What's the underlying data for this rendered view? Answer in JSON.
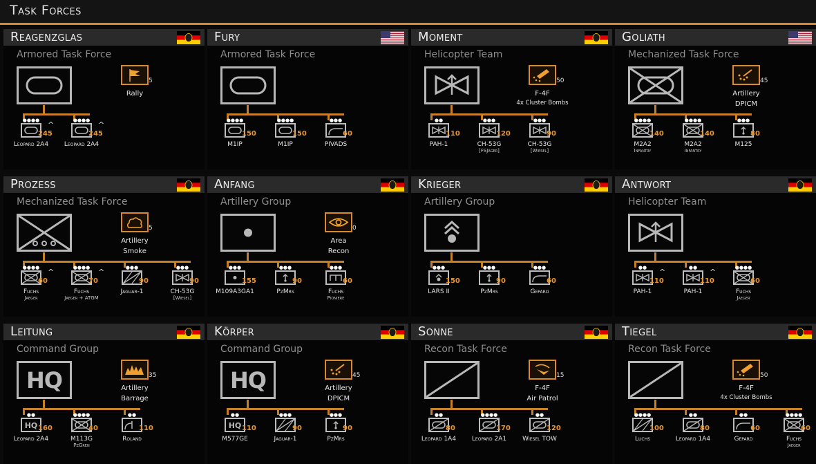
{
  "header": {
    "title": "Task Forces"
  },
  "colors": {
    "accent": "#d9892f",
    "header_bg": "#2a2a2a",
    "symbol": "#b8b8b8"
  },
  "cards": [
    {
      "name": "Reagenzglas",
      "flag": "germany-flag-icon",
      "type": "Armored Task Force",
      "hq": "armor",
      "support": {
        "label": "Rally",
        "sub": "",
        "count": "5",
        "icon": "flag-icon"
      },
      "units": [
        {
          "dots": "●●●●",
          "icon": "tank",
          "count": "245",
          "name": "Leopard 2A4",
          "sub": "",
          "caret": "^"
        },
        {
          "dots": "●●●●",
          "icon": "tank",
          "count": "245",
          "name": "Leopard 2A4",
          "sub": "",
          "caret": "^"
        }
      ]
    },
    {
      "name": "Fury",
      "flag": "usa-flag-icon",
      "type": "Armored Task Force",
      "hq": "armor",
      "support": null,
      "units": [
        {
          "dots": "●●●●",
          "icon": "tank",
          "count": "150",
          "name": "M1IP",
          "sub": "",
          "caret": ""
        },
        {
          "dots": "●●●●",
          "icon": "tank",
          "count": "150",
          "name": "M1IP",
          "sub": "",
          "caret": ""
        },
        {
          "dots": "●●●",
          "icon": "aa-gun",
          "count": "60",
          "name": "PIVADS",
          "sub": "",
          "caret": ""
        }
      ]
    },
    {
      "name": "Moment",
      "flag": "germany-flag-icon",
      "type": "Helicopter Team",
      "hq": "heli",
      "support": {
        "label": "F-4F",
        "sub": "4x Cluster Bombs",
        "count": "50",
        "icon": "cluster-bomb-icon"
      },
      "units": [
        {
          "dots": "●●",
          "icon": "heli",
          "count": "110",
          "name": "PAH-1",
          "sub": "",
          "caret": ""
        },
        {
          "dots": "●●●",
          "icon": "heli",
          "count": "120",
          "name": "CH-53G",
          "sub": "[FSJäger]",
          "caret": ""
        },
        {
          "dots": "●●●",
          "icon": "heli",
          "count": "90",
          "name": "CH-53G",
          "sub": "[Wiesel]",
          "caret": ""
        }
      ]
    },
    {
      "name": "Goliath",
      "flag": "usa-flag-icon",
      "type": "Mechanized Task Force",
      "hq": "mech",
      "support": {
        "label": "Artillery",
        "sub": "DPICM",
        "count": "45",
        "icon": "dpicm-icon"
      },
      "units": [
        {
          "dots": "●●●●",
          "icon": "ifv",
          "count": "140",
          "name": "M2A2",
          "sub": "Infantry",
          "caret": ""
        },
        {
          "dots": "●●●●",
          "icon": "ifv",
          "count": "140",
          "name": "M2A2",
          "sub": "Infantry",
          "caret": ""
        },
        {
          "dots": "●●●",
          "icon": "mortar",
          "count": "80",
          "name": "M125",
          "sub": "",
          "caret": ""
        }
      ]
    },
    {
      "name": "Prozess",
      "flag": "germany-flag-icon",
      "type": "Mechanized Task Force",
      "hq": "mech-wheeled",
      "support": {
        "label": "Artillery",
        "sub": "Smoke",
        "count": "5",
        "icon": "smoke-icon"
      },
      "units": [
        {
          "dots": "●●●●",
          "icon": "ifv",
          "count": "60",
          "name": "Fuchs",
          "sub": "Jaeger",
          "caret": "^"
        },
        {
          "dots": "●●●●",
          "icon": "ifv",
          "count": "70",
          "name": "Fuchs",
          "sub": "Jaeger + ATGM",
          "caret": "^"
        },
        {
          "dots": "●●●",
          "icon": "recon",
          "count": "90",
          "name": "Jaguar-1",
          "sub": "",
          "caret": ""
        },
        {
          "dots": "●●●",
          "icon": "heli",
          "count": "90",
          "name": "CH-53G",
          "sub": "[Wiesel]",
          "caret": ""
        }
      ]
    },
    {
      "name": "Anfang",
      "flag": "germany-flag-icon",
      "type": "Artillery Group",
      "hq": "artillery",
      "support": {
        "label": "Area",
        "sub": "Recon",
        "count": "0",
        "icon": "eye-icon"
      },
      "units": [
        {
          "dots": "●●●",
          "icon": "artillery",
          "count": "155",
          "name": "M109A3GA1",
          "sub": "",
          "caret": ""
        },
        {
          "dots": "●●●",
          "icon": "mortar",
          "count": "90",
          "name": "PzMrs",
          "sub": "",
          "caret": ""
        },
        {
          "dots": "●●●",
          "icon": "engineer",
          "count": "60",
          "name": "Fuchs",
          "sub": "Pioniere",
          "caret": ""
        }
      ]
    },
    {
      "name": "Krieger",
      "flag": "germany-flag-icon",
      "type": "Artillery Group",
      "hq": "rocket",
      "support": null,
      "units": [
        {
          "dots": "●●●",
          "icon": "rocket",
          "count": "150",
          "name": "LARS II",
          "sub": "",
          "caret": ""
        },
        {
          "dots": "●●●",
          "icon": "mortar",
          "count": "90",
          "name": "PzMrs",
          "sub": "",
          "caret": ""
        },
        {
          "dots": "●●●",
          "icon": "aa-gun",
          "count": "60",
          "name": "Gepard",
          "sub": "",
          "caret": ""
        }
      ]
    },
    {
      "name": "Antwort",
      "flag": "germany-flag-icon",
      "type": "Helicopter Team",
      "hq": "heli",
      "support": null,
      "units": [
        {
          "dots": "●●",
          "icon": "heli",
          "count": "110",
          "name": "PAH-1",
          "sub": "",
          "caret": "^"
        },
        {
          "dots": "●●",
          "icon": "heli",
          "count": "110",
          "name": "PAH-1",
          "sub": "",
          "caret": "^"
        },
        {
          "dots": "●●●●",
          "icon": "ifv",
          "count": "60",
          "name": "Fuchs",
          "sub": "Jaeger",
          "caret": ""
        }
      ]
    },
    {
      "name": "Leitung",
      "flag": "germany-flag-icon",
      "type": "Command Group",
      "hq": "hq",
      "support": {
        "label": "Artillery",
        "sub": "Barrage",
        "count": "35",
        "icon": "barrage-icon"
      },
      "units": [
        {
          "dots": "●●",
          "icon": "hq",
          "count": "160",
          "name": "Leopard 2A4",
          "sub": "",
          "caret": ""
        },
        {
          "dots": "●●●●",
          "icon": "ifv",
          "count": "40",
          "name": "M113G",
          "sub": "PzGren",
          "caret": ""
        },
        {
          "dots": "●●",
          "icon": "sam",
          "count": "110",
          "name": "Roland",
          "sub": "",
          "caret": ""
        }
      ]
    },
    {
      "name": "Körper",
      "flag": "germany-flag-icon",
      "type": "Command Group",
      "hq": "hq",
      "support": {
        "label": "Artillery",
        "sub": "DPICM",
        "count": "45",
        "icon": "dpicm-icon"
      },
      "units": [
        {
          "dots": "●●",
          "icon": "hq",
          "count": "110",
          "name": "M577GE",
          "sub": "",
          "caret": ""
        },
        {
          "dots": "●●●",
          "icon": "recon",
          "count": "90",
          "name": "Jaguar-1",
          "sub": "",
          "caret": ""
        },
        {
          "dots": "●●●",
          "icon": "mortar",
          "count": "90",
          "name": "PzMrs",
          "sub": "",
          "caret": ""
        }
      ]
    },
    {
      "name": "Sonne",
      "flag": "germany-flag-icon",
      "type": "Recon Task Force",
      "hq": "recon",
      "support": {
        "label": "F-4F",
        "sub": "Air Patrol",
        "count": "15",
        "icon": "air-patrol-icon"
      },
      "units": [
        {
          "dots": "●●",
          "icon": "recon-tank",
          "count": "80",
          "name": "Leopard 1A4",
          "sub": "",
          "caret": ""
        },
        {
          "dots": "●●●●",
          "icon": "recon-tank",
          "count": "170",
          "name": "Leopard 2A1",
          "sub": "",
          "caret": ""
        },
        {
          "dots": "●●",
          "icon": "recon-tank",
          "count": "120",
          "name": "Wiesel TOW",
          "sub": "",
          "caret": ""
        }
      ]
    },
    {
      "name": "Tiegel",
      "flag": "germany-flag-icon",
      "type": "Recon Task Force",
      "hq": "recon",
      "support": {
        "label": "F-4F",
        "sub": "4x Cluster Bombs",
        "count": "50",
        "icon": "cluster-bomb-icon"
      },
      "units": [
        {
          "dots": "●●●●",
          "icon": "recon",
          "count": "100",
          "name": "Luchs",
          "sub": "",
          "caret": ""
        },
        {
          "dots": "●●",
          "icon": "recon-tank",
          "count": "80",
          "name": "Leopard 1A4",
          "sub": "",
          "caret": ""
        },
        {
          "dots": "●●",
          "icon": "aa-gun",
          "count": "60",
          "name": "Gepard",
          "sub": "",
          "caret": ""
        },
        {
          "dots": "●●●●",
          "icon": "ifv",
          "count": "60",
          "name": "Fuchs",
          "sub": "Jaeger",
          "caret": ""
        }
      ]
    }
  ]
}
